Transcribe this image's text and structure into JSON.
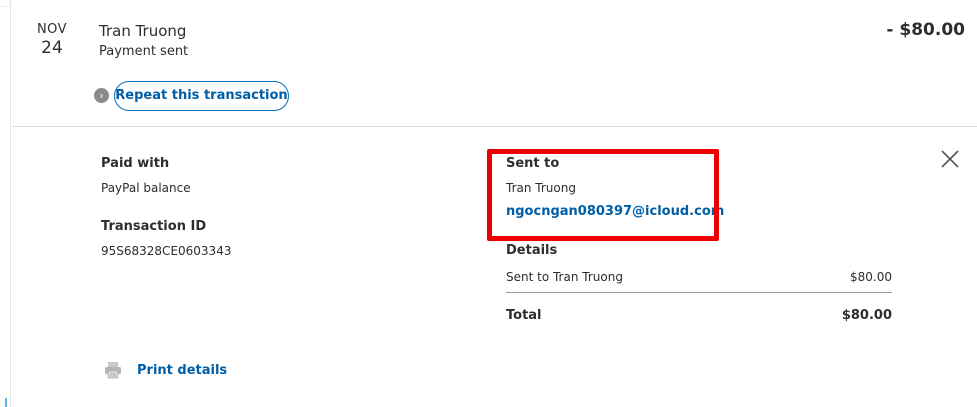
{
  "transaction": {
    "month": "NOV",
    "day": "24",
    "name": "Tran Truong",
    "status": "Payment sent",
    "amount": "- $80.00",
    "repeat_label": "Repeat this transaction"
  },
  "payment": {
    "paid_with_label": "Paid with",
    "paid_with_value": "PayPal balance",
    "transaction_id_label": "Transaction ID",
    "transaction_id_value": "95S68328CE0603343"
  },
  "recipient": {
    "sent_to_label": "Sent to",
    "name": "Tran Truong",
    "email": "ngocngan080397@icloud.com"
  },
  "details": {
    "label": "Details",
    "rows": [
      {
        "description": "Sent to Tran Truong",
        "amount": "$80.00"
      }
    ],
    "total_label": "Total",
    "total_amount": "$80.00"
  },
  "actions": {
    "print_label": "Print details"
  },
  "colors": {
    "link": "#005ea6",
    "highlight": "#ee0000"
  },
  "icons": {
    "chevron": "chevron-right-icon",
    "close": "close-icon",
    "print": "printer-icon"
  }
}
